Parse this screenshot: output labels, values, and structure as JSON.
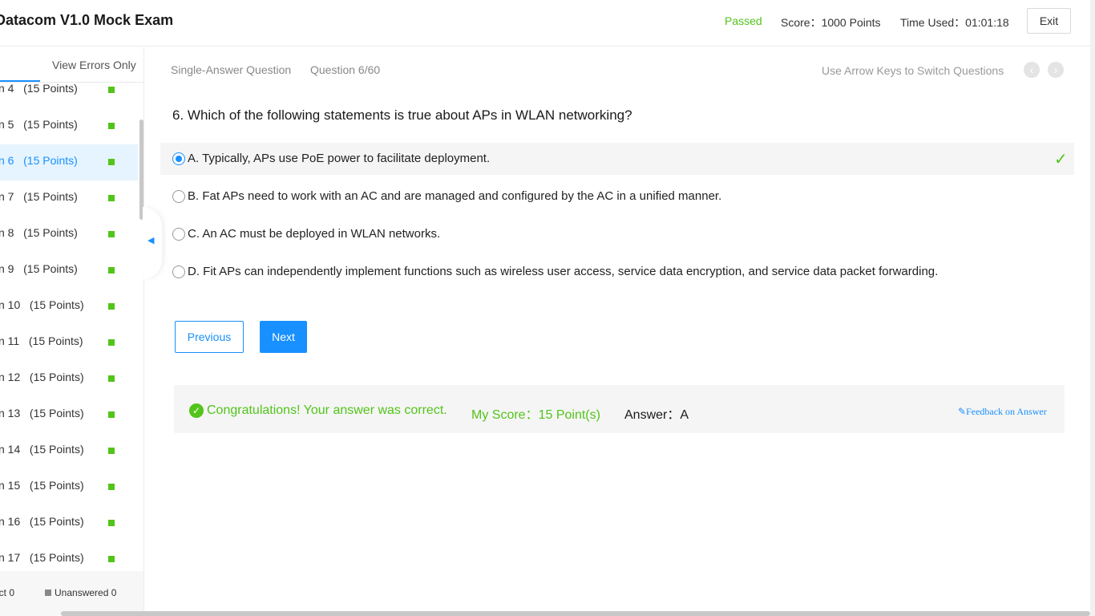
{
  "header": {
    "title": "Datacom V1.0 Mock Exam",
    "status": "Passed",
    "score": "Score：1000 Points",
    "time_used": "Time Used：01:01:18",
    "exit_label": "Exit"
  },
  "sidebar": {
    "view_errors_label": "View Errors Only",
    "items": [
      {
        "label": "n 4   (15 Points)"
      },
      {
        "label": "n 5   (15 Points)"
      },
      {
        "label": "n 6   (15 Points)"
      },
      {
        "label": "n 7   (15 Points)"
      },
      {
        "label": "n 8   (15 Points)"
      },
      {
        "label": "n 9   (15 Points)"
      },
      {
        "label": "n 10   (15 Points)"
      },
      {
        "label": "n 11   (15 Points)"
      },
      {
        "label": "n 12   (15 Points)"
      },
      {
        "label": "n 13   (15 Points)"
      },
      {
        "label": "n 14   (15 Points)"
      },
      {
        "label": "n 15   (15 Points)"
      },
      {
        "label": "n 16   (15 Points)"
      },
      {
        "label": "n 17   (15 Points)"
      }
    ],
    "active_index": 2,
    "footer": {
      "correct": "ect 0",
      "unanswered": "Unanswered 0"
    }
  },
  "main": {
    "question_type": "Single-Answer Question",
    "question_number": "Question 6/60",
    "arrow_hint": "Use Arrow Keys to Switch Questions",
    "question_text": "6. Which of the following statements is true about APs in WLAN networking?",
    "options": [
      {
        "text": "A. Typically, APs use PoE power to facilitate deployment."
      },
      {
        "text": "B. Fat APs need to work with an AC and are managed and configured by the AC in a unified manner."
      },
      {
        "text": "C. An AC must be deployed in WLAN networks."
      },
      {
        "text": "D. Fit APs can independently implement functions such as wireless user access, service data encryption, and service data packet forwarding."
      }
    ],
    "selected_option": "A",
    "previous_label": "Previous",
    "next_label": "Next",
    "result": {
      "message": "Congratulations! Your answer was correct.",
      "my_score": "My Score：15 Point(s)",
      "answer": "Answer：A",
      "feedback": "Feedback on Answer"
    }
  },
  "colors": {
    "accent": "#1890ff",
    "success": "#52c41a"
  },
  "icons": {
    "prev": "chevron-left-icon",
    "next": "chevron-right-icon",
    "correct": "checkmark-icon",
    "collapse": "triangle-left-icon",
    "feedback": "edit-icon"
  }
}
